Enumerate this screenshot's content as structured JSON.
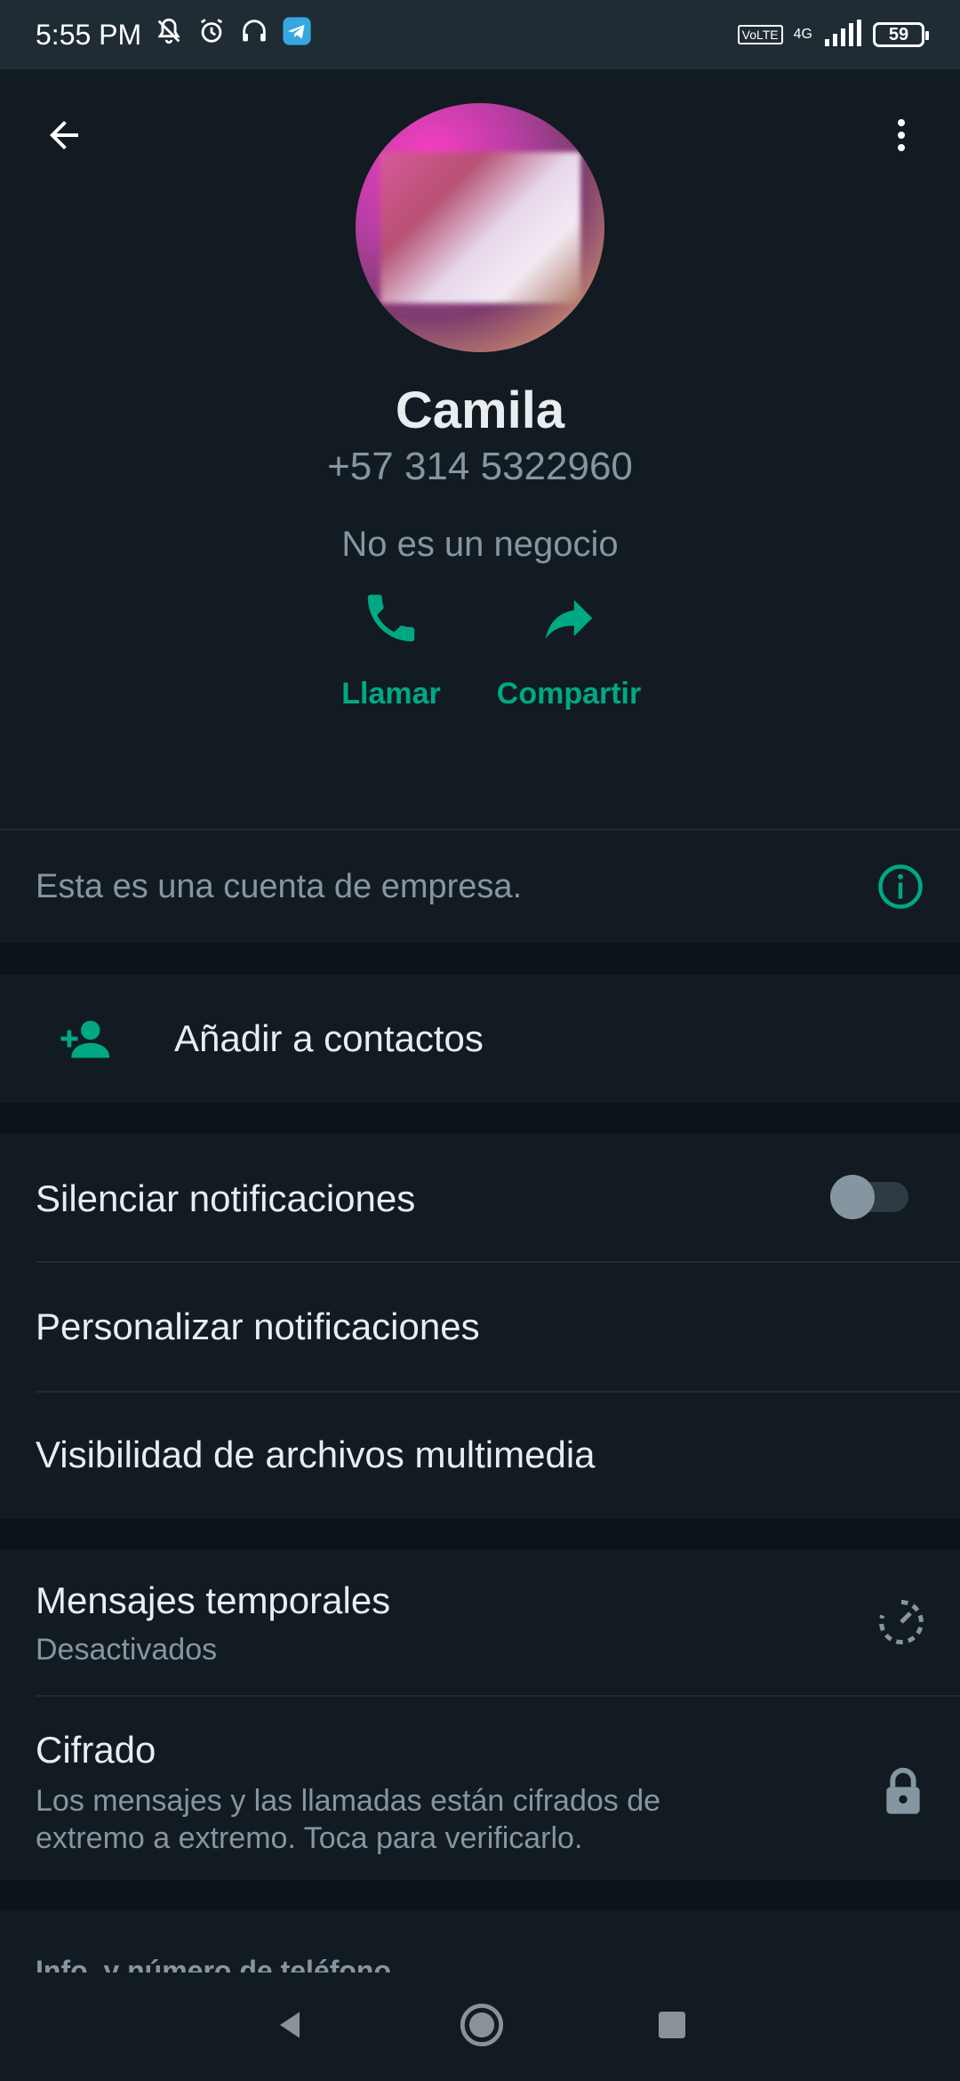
{
  "status_bar": {
    "time": "5:55 PM",
    "network": "4G",
    "volte": "Vo LTE",
    "battery": "59",
    "icons": [
      "bell-off-icon",
      "alarm-icon",
      "headphones-icon",
      "telegram-icon",
      "signal-icon"
    ]
  },
  "header": {
    "back_icon": "arrow-left-icon",
    "menu_icon": "more-vert-icon"
  },
  "profile": {
    "name": "Camila",
    "phone": "+57 314 5322960",
    "business_note": "No es un negocio"
  },
  "actions": [
    {
      "label": "Llamar",
      "icon": "phone-icon"
    },
    {
      "label": "Compartir",
      "icon": "share-icon"
    }
  ],
  "business_account": {
    "text": "Esta es una cuenta de empresa.",
    "icon": "info-icon"
  },
  "add_contact": {
    "label": "Añadir a contactos",
    "icon": "person-add-icon"
  },
  "notifications": {
    "mute_label": "Silenciar notificaciones",
    "mute_enabled": false,
    "custom_label": "Personalizar notificaciones",
    "media_label": "Visibilidad de archivos multimedia"
  },
  "privacy": {
    "disappearing_title": "Mensajes temporales",
    "disappearing_value": "Desactivados",
    "encryption_title": "Cifrado",
    "encryption_desc_line1": "Los mensajes y las llamadas están cifrados de",
    "encryption_desc_line2": "extremo a extremo. Toca para verificarlo."
  },
  "info_section": {
    "title": "Info. y número de teléfono"
  },
  "colors": {
    "accent": "#00a884",
    "background": "#0b141a",
    "surface": "#111b21",
    "text_primary": "#e9edef",
    "text_secondary": "#8696a0"
  }
}
